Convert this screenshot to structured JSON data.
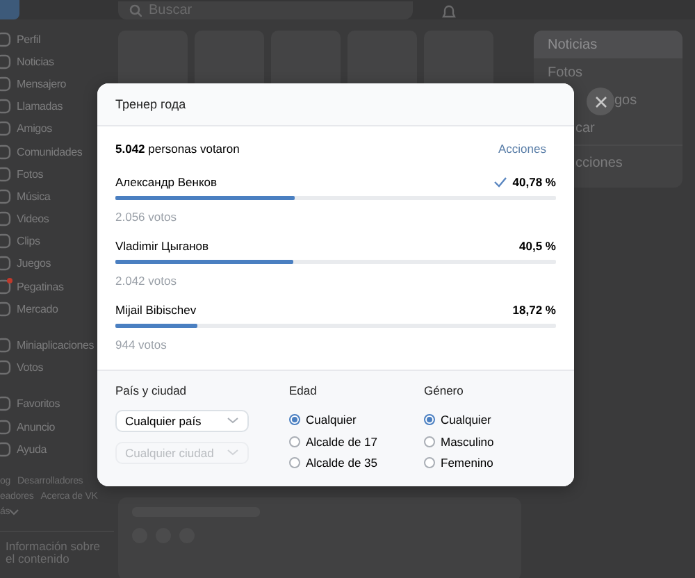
{
  "top_bar": {
    "search": {
      "placeholder": "Buscar"
    }
  },
  "sidebar": {
    "groups": [
      [
        {
          "label": "Perfil",
          "notification": false
        },
        {
          "label": "Noticias",
          "notification": false
        },
        {
          "label": "Mensajero",
          "notification": false
        },
        {
          "label": "Llamadas",
          "notification": false
        },
        {
          "label": "Amigos",
          "notification": false
        },
        {
          "label": "Comunidades",
          "notification": false
        },
        {
          "label": "Fotos",
          "notification": false
        },
        {
          "label": "Música",
          "notification": false
        },
        {
          "label": "Videos",
          "notification": false
        },
        {
          "label": "Clips",
          "notification": false
        },
        {
          "label": "Juegos",
          "notification": false
        },
        {
          "label": "Pegatinas",
          "notification": true
        },
        {
          "label": "Mercado",
          "notification": false
        }
      ],
      [
        {
          "label": "Miniaplicaciones",
          "notification": false
        },
        {
          "label": "Votos",
          "notification": false
        }
      ],
      [
        {
          "label": "Favoritos",
          "notification": false
        },
        {
          "label": "Anuncio",
          "notification": false
        },
        {
          "label": "Ayuda",
          "notification": false
        }
      ]
    ],
    "footer_links": [
      [
        "og",
        "Desarrolladores"
      ],
      [
        "eadores",
        "Acerca de VK"
      ],
      [
        "ás"
      ]
    ],
    "info": "Información sobre el contenido"
  },
  "right_panel": {
    "items": [
      {
        "label": "Noticias",
        "selected": true
      },
      {
        "label": "Fotos",
        "selected": false
      },
      {
        "label": "gos",
        "selected": false
      },
      {
        "label": "car",
        "selected": false
      },
      {
        "label": "cciones",
        "selected": false
      }
    ]
  },
  "poll": {
    "title": "Тренер года",
    "total": "**5.042** personas votaron",
    "actions": "Acciones",
    "options": [
      {
        "name": "Александр Венков",
        "percent": "40,78 %",
        "votes": "2.056 votos",
        "level": 0.4078,
        "chosen": true
      },
      {
        "name": "Vladimir Цыганов",
        "percent": "40,5 %",
        "votes": "2.042 votos",
        "level": 0.405,
        "chosen": false
      },
      {
        "name": "Mijail Bibischev",
        "percent": "18,72 %",
        "votes": "944 votos",
        "level": 0.1872,
        "chosen": false
      }
    ],
    "filters": {
      "location": {
        "label": "País y ciudad",
        "selects": [
          {
            "value": "Cualquier país",
            "disabled": false
          },
          {
            "value": "Cualquier ciudad",
            "disabled": true
          }
        ]
      },
      "age": {
        "label": "Edad",
        "options": [
          {
            "label": "Cualquier",
            "selected": true
          },
          {
            "label": "Alcalde de 17",
            "selected": false
          },
          {
            "label": "Alcalde de 35",
            "selected": false
          }
        ]
      },
      "gender": {
        "label": "Género",
        "options": [
          {
            "label": "Cualquier",
            "selected": true
          },
          {
            "label": "Masculino",
            "selected": false
          },
          {
            "label": "Femenino",
            "selected": false
          }
        ]
      }
    }
  }
}
